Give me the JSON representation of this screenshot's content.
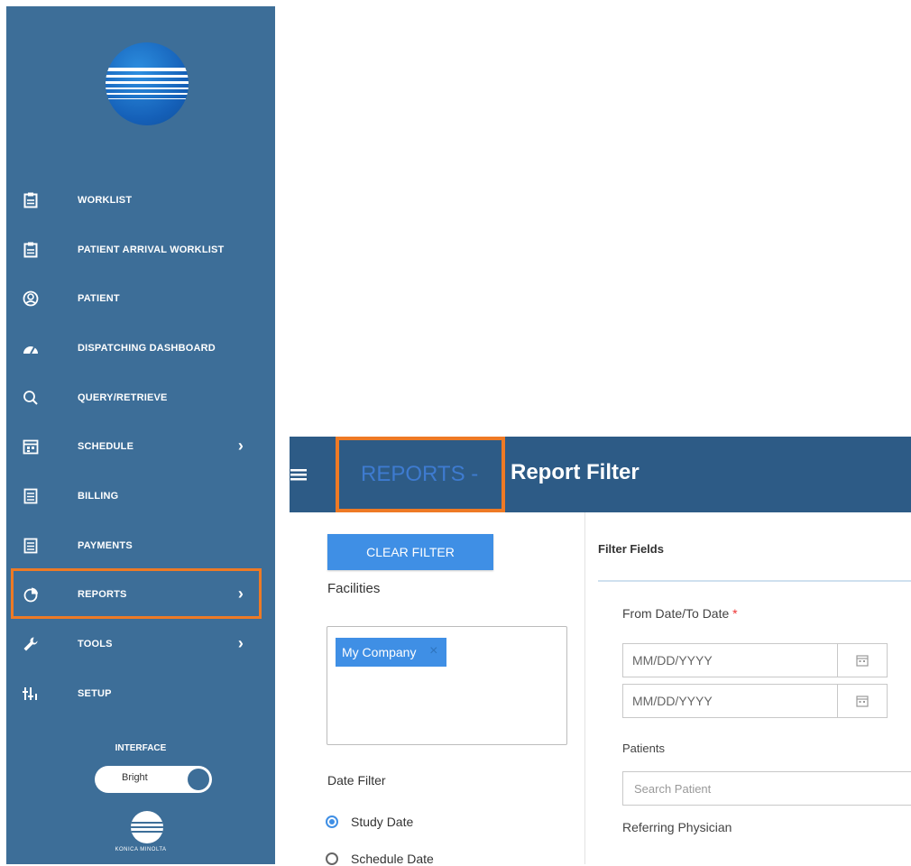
{
  "sidebar": {
    "items": [
      {
        "label": "WORKLIST",
        "icon": "clipboard-icon",
        "chevron": false
      },
      {
        "label": "PATIENT ARRIVAL WORKLIST",
        "icon": "clipboard-icon",
        "chevron": false
      },
      {
        "label": "PATIENT",
        "icon": "person-icon",
        "chevron": false
      },
      {
        "label": "DISPATCHING DASHBOARD",
        "icon": "dashboard-icon",
        "chevron": false
      },
      {
        "label": "QUERY/RETRIEVE",
        "icon": "search-icon",
        "chevron": false
      },
      {
        "label": "SCHEDULE",
        "icon": "calendar-icon",
        "chevron": true
      },
      {
        "label": "BILLING",
        "icon": "document-icon",
        "chevron": false
      },
      {
        "label": "PAYMENTS",
        "icon": "document-icon",
        "chevron": false
      },
      {
        "label": "REPORTS",
        "icon": "pie-chart-icon",
        "chevron": true
      },
      {
        "label": "TOOLS",
        "icon": "wrench-icon",
        "chevron": true
      },
      {
        "label": "SETUP",
        "icon": "setup-icon",
        "chevron": false
      }
    ],
    "interface_label": "INTERFACE",
    "theme_toggle_label": "Bright",
    "brand_text": "KONICA MINOLTA"
  },
  "header": {
    "breadcrumb": "REPORTS -",
    "title": "Report Filter"
  },
  "filters": {
    "clear_filter_label": "CLEAR FILTER",
    "facilities_label": "Facilities",
    "facility_chips": [
      "My Company"
    ],
    "date_filter_label": "Date Filter",
    "date_filter_options": [
      {
        "label": "Study Date",
        "selected": true
      },
      {
        "label": "Schedule Date",
        "selected": false
      }
    ],
    "filter_fields_label": "Filter Fields",
    "from_to_label": "From Date/To Date",
    "required_marker": "*",
    "from_date_placeholder": "MM/DD/YYYY",
    "to_date_placeholder": "MM/DD/YYYY",
    "patients_label": "Patients",
    "search_patient_placeholder": "Search Patient",
    "referring_physician_label": "Referring Physician"
  },
  "colors": {
    "sidebar_bg": "#3d6e98",
    "header_bg": "#2d5b86",
    "accent": "#3f8fe5",
    "highlight": "#ee7a25"
  }
}
